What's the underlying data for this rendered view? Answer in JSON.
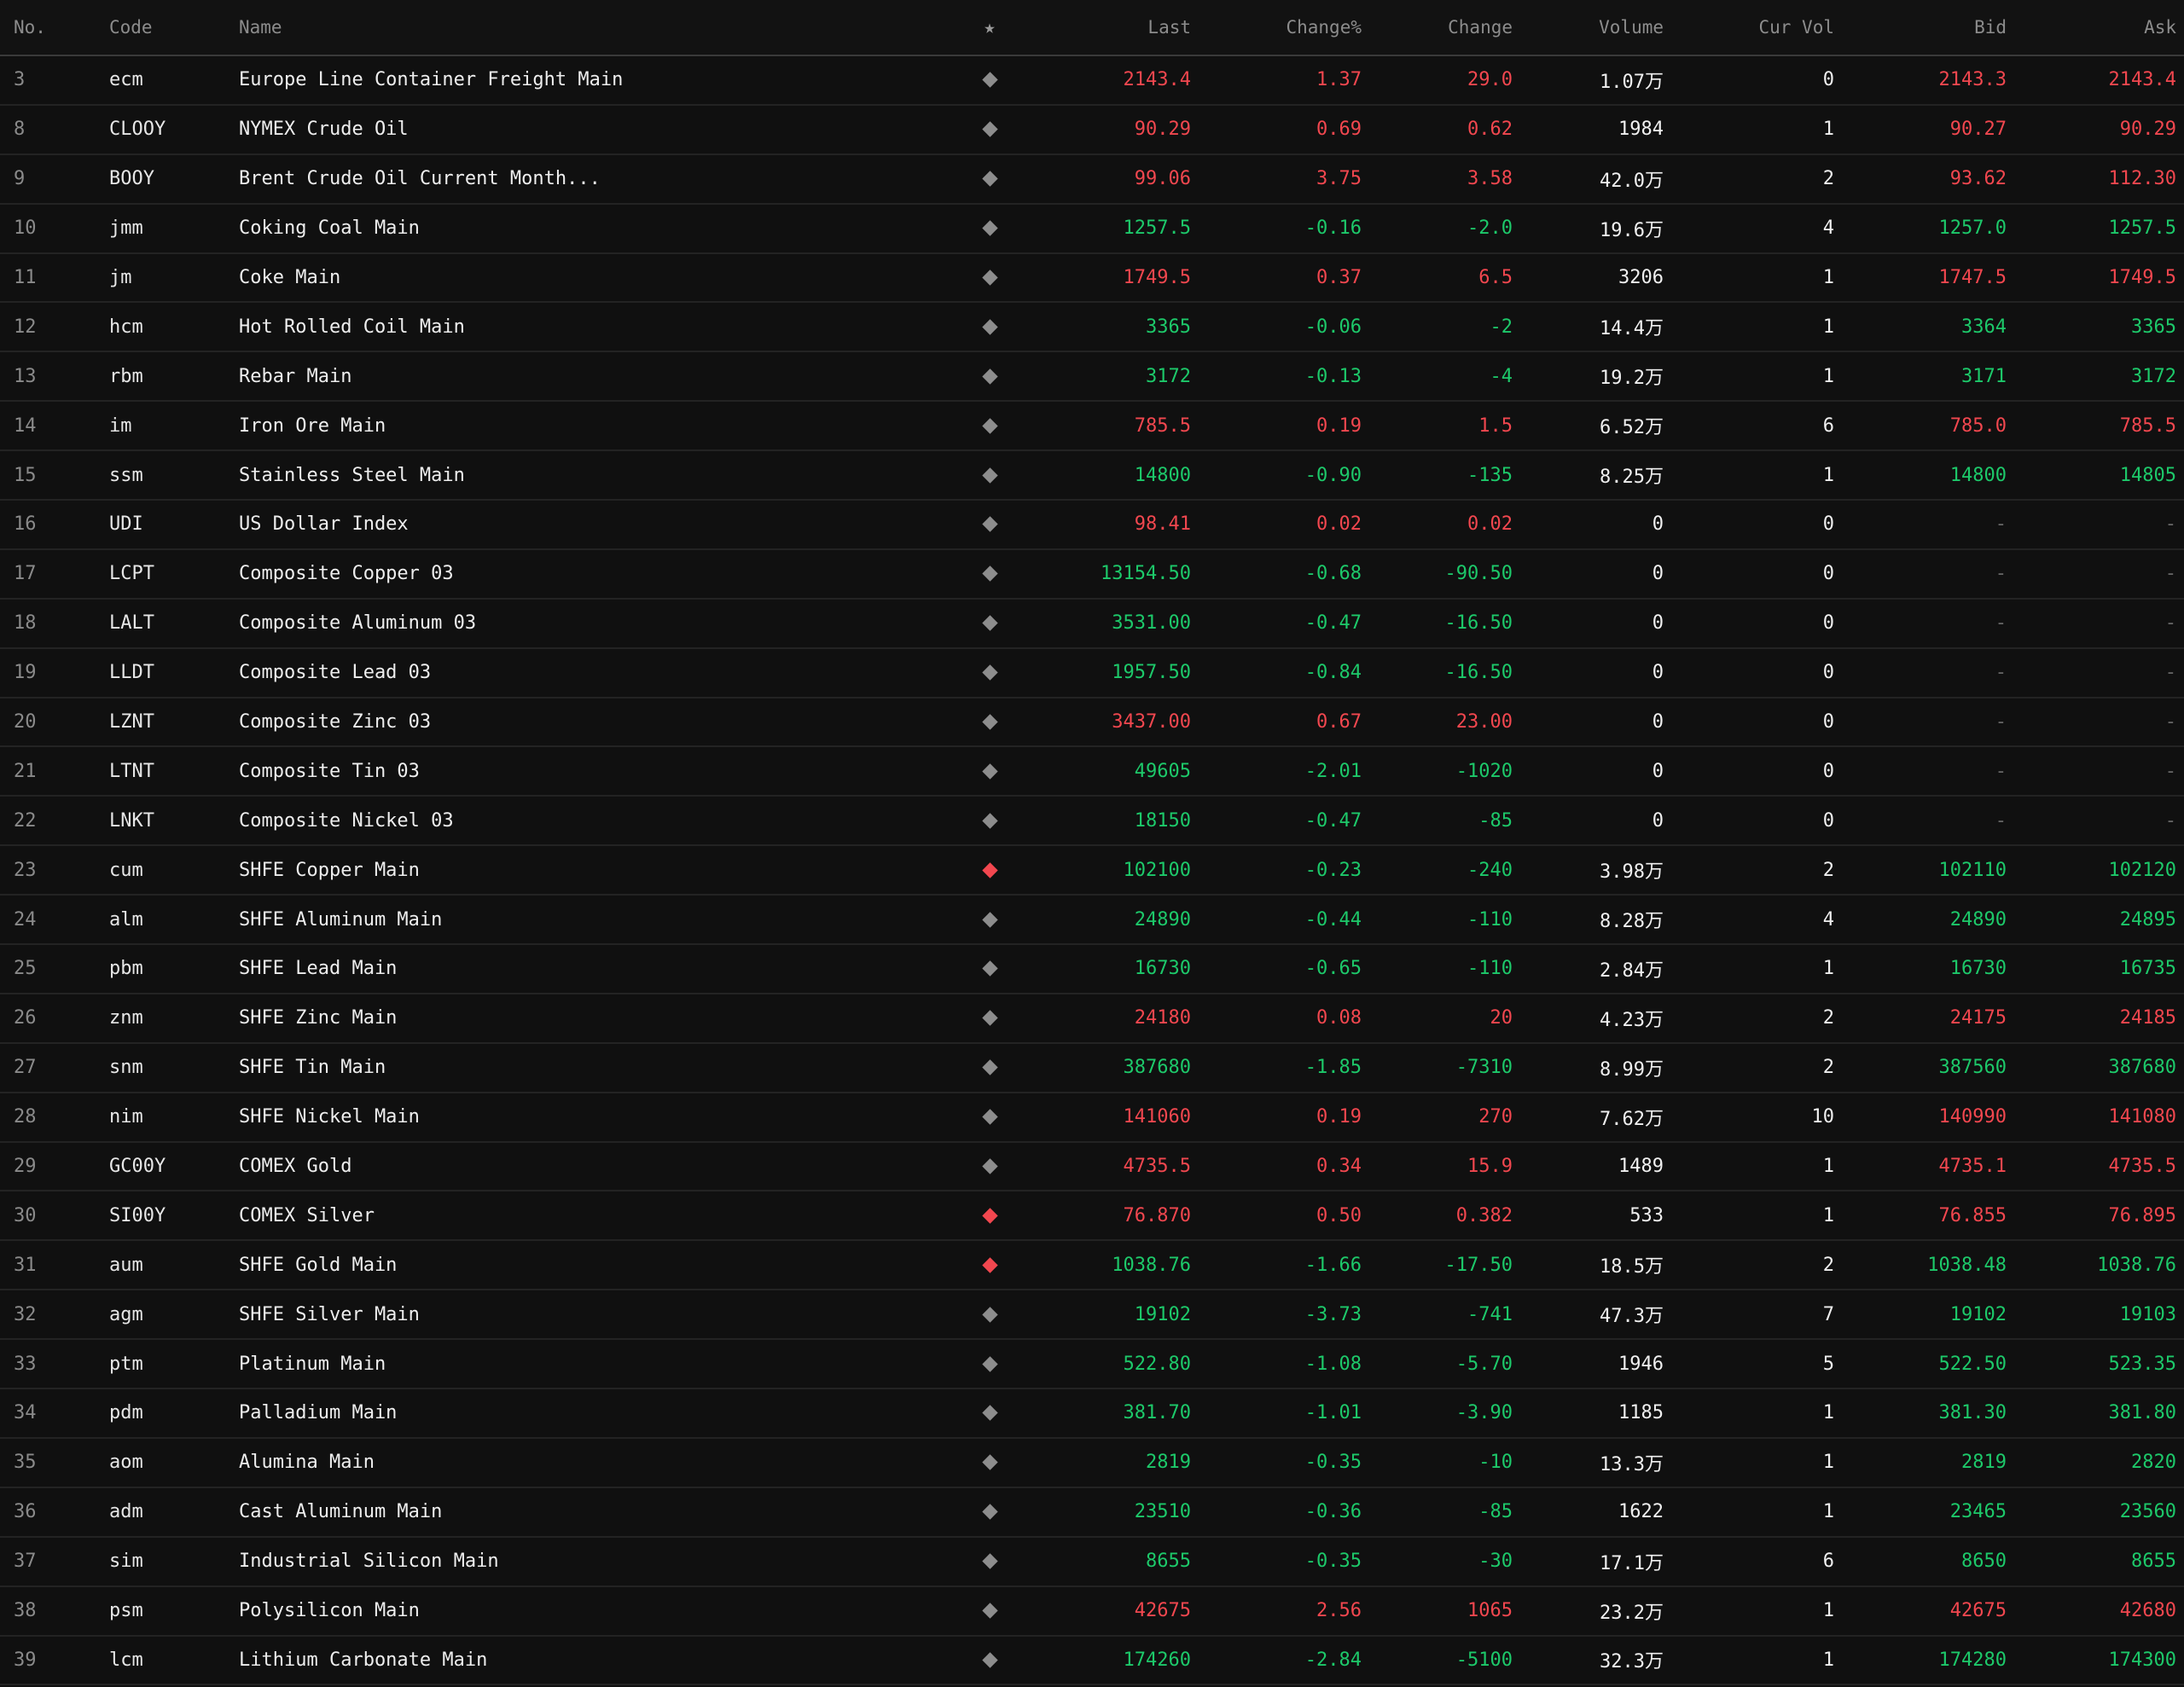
{
  "headers": {
    "no": "No.",
    "code": "Code",
    "name": "Name",
    "star": "★",
    "last": "Last",
    "change_pct": "Change%",
    "change": "Change",
    "volume": "Volume",
    "cur_vol": "Cur Vol",
    "bid": "Bid",
    "ask": "Ask"
  },
  "colors": {
    "up": "#f2474f",
    "down": "#1dc96a",
    "flat": "#666666"
  },
  "rows": [
    {
      "no": "3",
      "code": "ecm",
      "name": "Europe Line Container Freight Main",
      "fav": false,
      "dir": "up",
      "last": "2143.4",
      "change_pct": "1.37",
      "change": "29.0",
      "volume": "1.07万",
      "cur_vol": "0",
      "bid": "2143.3",
      "ask": "2143.4"
    },
    {
      "no": "8",
      "code": "CLOOY",
      "name": "NYMEX Crude Oil",
      "fav": false,
      "dir": "up",
      "last": "90.29",
      "change_pct": "0.69",
      "change": "0.62",
      "volume": "1984",
      "cur_vol": "1",
      "bid": "90.27",
      "ask": "90.29"
    },
    {
      "no": "9",
      "code": "BOOY",
      "name": "Brent Crude Oil Current Month...",
      "fav": false,
      "dir": "up",
      "last": "99.06",
      "change_pct": "3.75",
      "change": "3.58",
      "volume": "42.0万",
      "cur_vol": "2",
      "bid": "93.62",
      "ask": "112.30"
    },
    {
      "no": "10",
      "code": "jmm",
      "name": "Coking Coal Main",
      "fav": false,
      "dir": "down",
      "last": "1257.5",
      "change_pct": "-0.16",
      "change": "-2.0",
      "volume": "19.6万",
      "cur_vol": "4",
      "bid": "1257.0",
      "ask": "1257.5"
    },
    {
      "no": "11",
      "code": "jm",
      "name": "Coke Main",
      "fav": false,
      "dir": "up",
      "last": "1749.5",
      "change_pct": "0.37",
      "change": "6.5",
      "volume": "3206",
      "cur_vol": "1",
      "bid": "1747.5",
      "ask": "1749.5"
    },
    {
      "no": "12",
      "code": "hcm",
      "name": "Hot Rolled Coil Main",
      "fav": false,
      "dir": "down",
      "last": "3365",
      "change_pct": "-0.06",
      "change": "-2",
      "volume": "14.4万",
      "cur_vol": "1",
      "bid": "3364",
      "ask": "3365"
    },
    {
      "no": "13",
      "code": "rbm",
      "name": "Rebar Main",
      "fav": false,
      "dir": "down",
      "last": "3172",
      "change_pct": "-0.13",
      "change": "-4",
      "volume": "19.2万",
      "cur_vol": "1",
      "bid": "3171",
      "ask": "3172"
    },
    {
      "no": "14",
      "code": "im",
      "name": "Iron Ore Main",
      "fav": false,
      "dir": "up",
      "last": "785.5",
      "change_pct": "0.19",
      "change": "1.5",
      "volume": "6.52万",
      "cur_vol": "6",
      "bid": "785.0",
      "ask": "785.5"
    },
    {
      "no": "15",
      "code": "ssm",
      "name": "Stainless Steel Main",
      "fav": false,
      "dir": "down",
      "last": "14800",
      "change_pct": "-0.90",
      "change": "-135",
      "volume": "8.25万",
      "cur_vol": "1",
      "bid": "14800",
      "ask": "14805"
    },
    {
      "no": "16",
      "code": "UDI",
      "name": "US Dollar Index",
      "fav": false,
      "dir": "up",
      "last": "98.41",
      "change_pct": "0.02",
      "change": "0.02",
      "volume": "0",
      "cur_vol": "0",
      "bid": "-",
      "ask": "-"
    },
    {
      "no": "17",
      "code": "LCPT",
      "name": "Composite Copper 03",
      "fav": false,
      "dir": "down",
      "last": "13154.50",
      "change_pct": "-0.68",
      "change": "-90.50",
      "volume": "0",
      "cur_vol": "0",
      "bid": "-",
      "ask": "-"
    },
    {
      "no": "18",
      "code": "LALT",
      "name": "Composite Aluminum 03",
      "fav": false,
      "dir": "down",
      "last": "3531.00",
      "change_pct": "-0.47",
      "change": "-16.50",
      "volume": "0",
      "cur_vol": "0",
      "bid": "-",
      "ask": "-"
    },
    {
      "no": "19",
      "code": "LLDT",
      "name": "Composite Lead 03",
      "fav": false,
      "dir": "down",
      "last": "1957.50",
      "change_pct": "-0.84",
      "change": "-16.50",
      "volume": "0",
      "cur_vol": "0",
      "bid": "-",
      "ask": "-"
    },
    {
      "no": "20",
      "code": "LZNT",
      "name": "Composite Zinc 03",
      "fav": false,
      "dir": "up",
      "last": "3437.00",
      "change_pct": "0.67",
      "change": "23.00",
      "volume": "0",
      "cur_vol": "0",
      "bid": "-",
      "ask": "-"
    },
    {
      "no": "21",
      "code": "LTNT",
      "name": "Composite Tin 03",
      "fav": false,
      "dir": "down",
      "last": "49605",
      "change_pct": "-2.01",
      "change": "-1020",
      "volume": "0",
      "cur_vol": "0",
      "bid": "-",
      "ask": "-"
    },
    {
      "no": "22",
      "code": "LNKT",
      "name": "Composite Nickel 03",
      "fav": false,
      "dir": "down",
      "last": "18150",
      "change_pct": "-0.47",
      "change": "-85",
      "volume": "0",
      "cur_vol": "0",
      "bid": "-",
      "ask": "-"
    },
    {
      "no": "23",
      "code": "cum",
      "name": "SHFE Copper Main",
      "fav": true,
      "dir": "down",
      "last": "102100",
      "change_pct": "-0.23",
      "change": "-240",
      "volume": "3.98万",
      "cur_vol": "2",
      "bid": "102110",
      "ask": "102120"
    },
    {
      "no": "24",
      "code": "alm",
      "name": "SHFE Aluminum Main",
      "fav": false,
      "dir": "down",
      "last": "24890",
      "change_pct": "-0.44",
      "change": "-110",
      "volume": "8.28万",
      "cur_vol": "4",
      "bid": "24890",
      "ask": "24895"
    },
    {
      "no": "25",
      "code": "pbm",
      "name": "SHFE Lead Main",
      "fav": false,
      "dir": "down",
      "last": "16730",
      "change_pct": "-0.65",
      "change": "-110",
      "volume": "2.84万",
      "cur_vol": "1",
      "bid": "16730",
      "ask": "16735"
    },
    {
      "no": "26",
      "code": "znm",
      "name": "SHFE Zinc Main",
      "fav": false,
      "dir": "up",
      "last": "24180",
      "change_pct": "0.08",
      "change": "20",
      "volume": "4.23万",
      "cur_vol": "2",
      "bid": "24175",
      "ask": "24185"
    },
    {
      "no": "27",
      "code": "snm",
      "name": "SHFE Tin Main",
      "fav": false,
      "dir": "down",
      "last": "387680",
      "change_pct": "-1.85",
      "change": "-7310",
      "volume": "8.99万",
      "cur_vol": "2",
      "bid": "387560",
      "ask": "387680"
    },
    {
      "no": "28",
      "code": "nim",
      "name": "SHFE Nickel Main",
      "fav": false,
      "dir": "up",
      "last": "141060",
      "change_pct": "0.19",
      "change": "270",
      "volume": "7.62万",
      "cur_vol": "10",
      "bid": "140990",
      "ask": "141080"
    },
    {
      "no": "29",
      "code": "GC00Y",
      "name": "COMEX Gold",
      "fav": false,
      "dir": "up",
      "last": "4735.5",
      "change_pct": "0.34",
      "change": "15.9",
      "volume": "1489",
      "cur_vol": "1",
      "bid": "4735.1",
      "ask": "4735.5"
    },
    {
      "no": "30",
      "code": "SI00Y",
      "name": "COMEX Silver",
      "fav": true,
      "dir": "up",
      "last": "76.870",
      "change_pct": "0.50",
      "change": "0.382",
      "volume": "533",
      "cur_vol": "1",
      "bid": "76.855",
      "ask": "76.895"
    },
    {
      "no": "31",
      "code": "aum",
      "name": "SHFE Gold Main",
      "fav": true,
      "dir": "down",
      "last": "1038.76",
      "change_pct": "-1.66",
      "change": "-17.50",
      "volume": "18.5万",
      "cur_vol": "2",
      "bid": "1038.48",
      "ask": "1038.76"
    },
    {
      "no": "32",
      "code": "agm",
      "name": "SHFE Silver Main",
      "fav": false,
      "dir": "down",
      "last": "19102",
      "change_pct": "-3.73",
      "change": "-741",
      "volume": "47.3万",
      "cur_vol": "7",
      "bid": "19102",
      "ask": "19103"
    },
    {
      "no": "33",
      "code": "ptm",
      "name": "Platinum Main",
      "fav": false,
      "dir": "down",
      "last": "522.80",
      "change_pct": "-1.08",
      "change": "-5.70",
      "volume": "1946",
      "cur_vol": "5",
      "bid": "522.50",
      "ask": "523.35"
    },
    {
      "no": "34",
      "code": "pdm",
      "name": "Palladium Main",
      "fav": false,
      "dir": "down",
      "last": "381.70",
      "change_pct": "-1.01",
      "change": "-3.90",
      "volume": "1185",
      "cur_vol": "1",
      "bid": "381.30",
      "ask": "381.80"
    },
    {
      "no": "35",
      "code": "aom",
      "name": "Alumina Main",
      "fav": false,
      "dir": "down",
      "last": "2819",
      "change_pct": "-0.35",
      "change": "-10",
      "volume": "13.3万",
      "cur_vol": "1",
      "bid": "2819",
      "ask": "2820"
    },
    {
      "no": "36",
      "code": "adm",
      "name": "Cast Aluminum Main",
      "fav": false,
      "dir": "down",
      "last": "23510",
      "change_pct": "-0.36",
      "change": "-85",
      "volume": "1622",
      "cur_vol": "1",
      "bid": "23465",
      "ask": "23560"
    },
    {
      "no": "37",
      "code": "sim",
      "name": "Industrial Silicon Main",
      "fav": false,
      "dir": "down",
      "last": "8655",
      "change_pct": "-0.35",
      "change": "-30",
      "volume": "17.1万",
      "cur_vol": "6",
      "bid": "8650",
      "ask": "8655"
    },
    {
      "no": "38",
      "code": "psm",
      "name": "Polysilicon Main",
      "fav": false,
      "dir": "up",
      "last": "42675",
      "change_pct": "2.56",
      "change": "1065",
      "volume": "23.2万",
      "cur_vol": "1",
      "bid": "42675",
      "ask": "42680"
    },
    {
      "no": "39",
      "code": "lcm",
      "name": "Lithium Carbonate Main",
      "fav": false,
      "dir": "down",
      "last": "174260",
      "change_pct": "-2.84",
      "change": "-5100",
      "volume": "32.3万",
      "cur_vol": "1",
      "bid": "174280",
      "ask": "174300"
    }
  ]
}
